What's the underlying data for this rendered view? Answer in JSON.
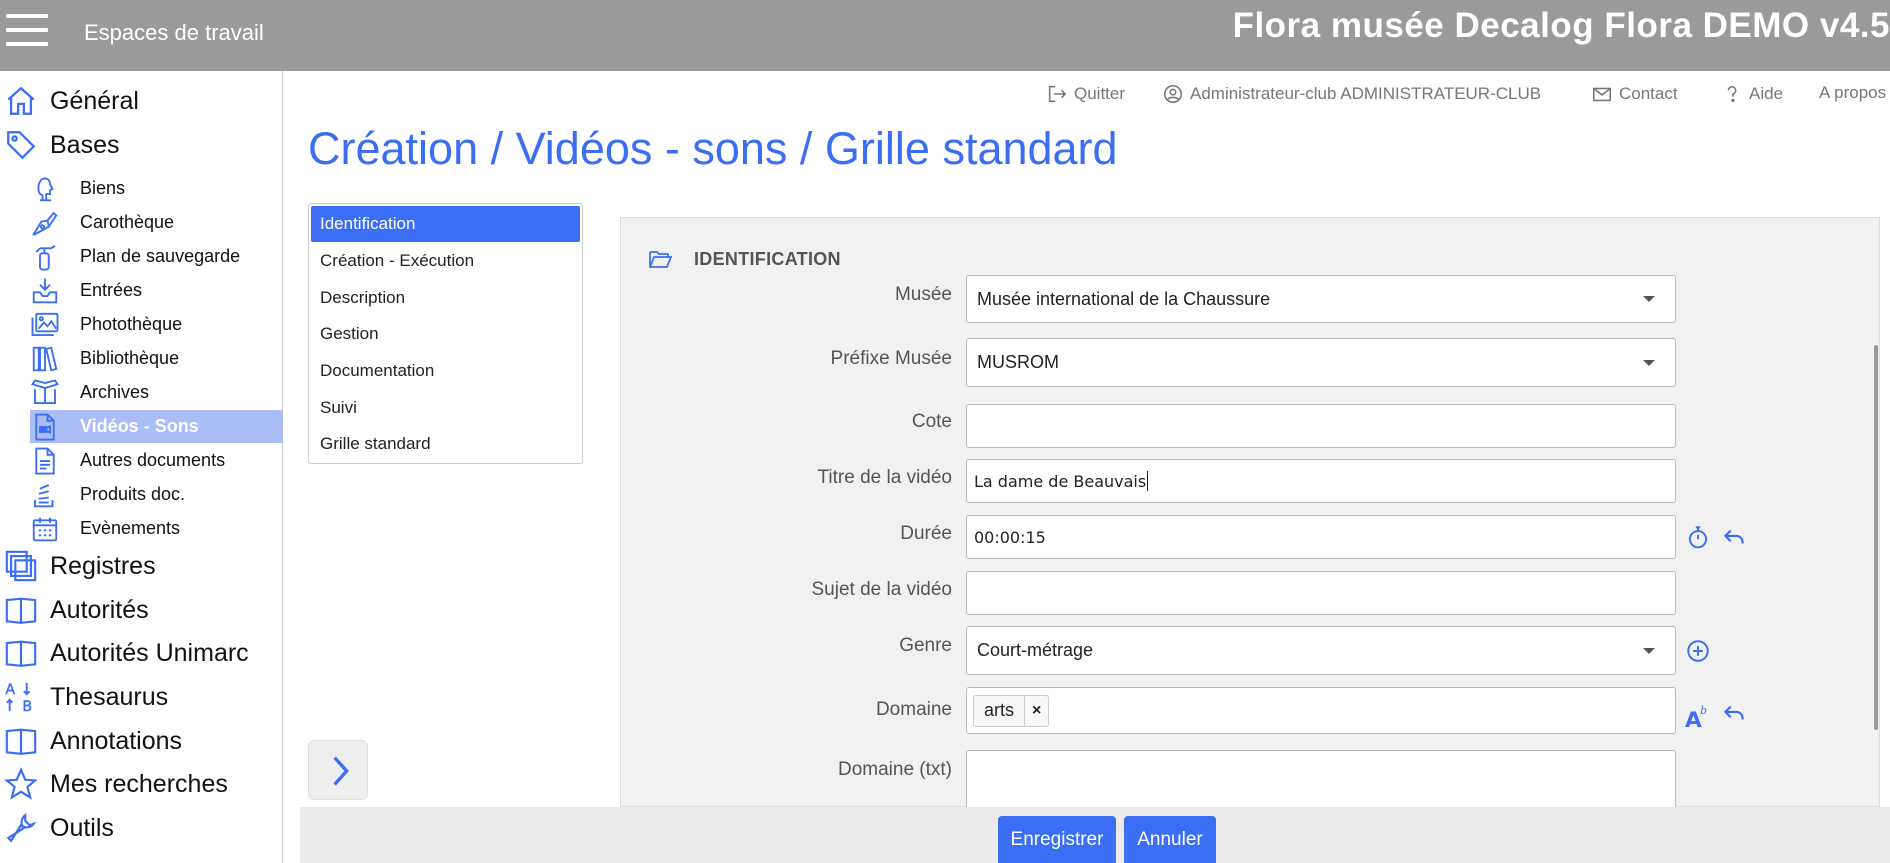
{
  "header": {
    "workspace_label": "Espaces de travail",
    "app_title": "Flora musée Decalog Flora DEMO v4.5"
  },
  "sidebar": {
    "top": [
      {
        "label": "Général",
        "icon": "home-icon"
      },
      {
        "label": "Bases",
        "icon": "tag-icon"
      }
    ],
    "sub": [
      {
        "label": "Biens",
        "icon": "bust-icon"
      },
      {
        "label": "Carothèque",
        "icon": "pen-nib-icon"
      },
      {
        "label": "Plan de sauvegarde",
        "icon": "fire-extinguisher-icon"
      },
      {
        "label": "Entrées",
        "icon": "inbox-download-icon"
      },
      {
        "label": "Photothèque",
        "icon": "images-icon"
      },
      {
        "label": "Bibliothèque",
        "icon": "books-icon"
      },
      {
        "label": "Archives",
        "icon": "box-open-icon"
      },
      {
        "label": "Vidéos - Sons",
        "icon": "video-file-icon"
      },
      {
        "label": "Autres documents",
        "icon": "file-text-icon"
      },
      {
        "label": "Produits doc.",
        "icon": "stack-icon"
      },
      {
        "label": "Evènements",
        "icon": "calendar-icon"
      }
    ],
    "bottom": [
      {
        "label": "Registres",
        "icon": "copy-icon"
      },
      {
        "label": "Autorités",
        "icon": "book-open-icon"
      },
      {
        "label": "Autorités Unimarc",
        "icon": "book-open-icon"
      },
      {
        "label": "Thesaurus",
        "icon": "sort-alpha-icon"
      },
      {
        "label": "Annotations",
        "icon": "book-open-icon"
      },
      {
        "label": "Mes recherches",
        "icon": "star-icon"
      },
      {
        "label": "Outils",
        "icon": "wrench-icon"
      }
    ],
    "active": "Vidéos - Sons"
  },
  "toolbar": {
    "quit": "Quitter",
    "user": "Administrateur-club ADMINISTRATEUR-CLUB",
    "contact": "Contact",
    "help": "Aide",
    "about": "A propos"
  },
  "page_title": "Création / Vidéos - sons / Grille standard",
  "tabs": [
    "Identification",
    "Création - Exécution",
    "Description",
    "Gestion",
    "Documentation",
    "Suivi",
    "Grille standard"
  ],
  "active_tab": "Identification",
  "section_title": "IDENTIFICATION",
  "form": {
    "musee": {
      "label": "Musée",
      "value": "Musée international de la Chaussure"
    },
    "prefixe": {
      "label": "Préfixe Musée",
      "value": "MUSROM"
    },
    "cote": {
      "label": "Cote",
      "value": ""
    },
    "titre": {
      "label": "Titre de la vidéo",
      "value": "La dame de Beauvais"
    },
    "duree": {
      "label": "Durée",
      "value": "00:00:15"
    },
    "sujet": {
      "label": "Sujet de la vidéo",
      "value": ""
    },
    "genre": {
      "label": "Genre",
      "value": "Court-métrage"
    },
    "domaine": {
      "label": "Domaine",
      "tags": [
        "arts"
      ],
      "remove_glyph": "×"
    },
    "domaine_txt": {
      "label": "Domaine (txt)",
      "value": ""
    }
  },
  "buttons": {
    "save": "Enregistrer",
    "cancel": "Annuler"
  },
  "colors": {
    "accent": "#3b6ef5",
    "topbar": "#9a9a9a",
    "active_nav": "#aabdf7"
  }
}
